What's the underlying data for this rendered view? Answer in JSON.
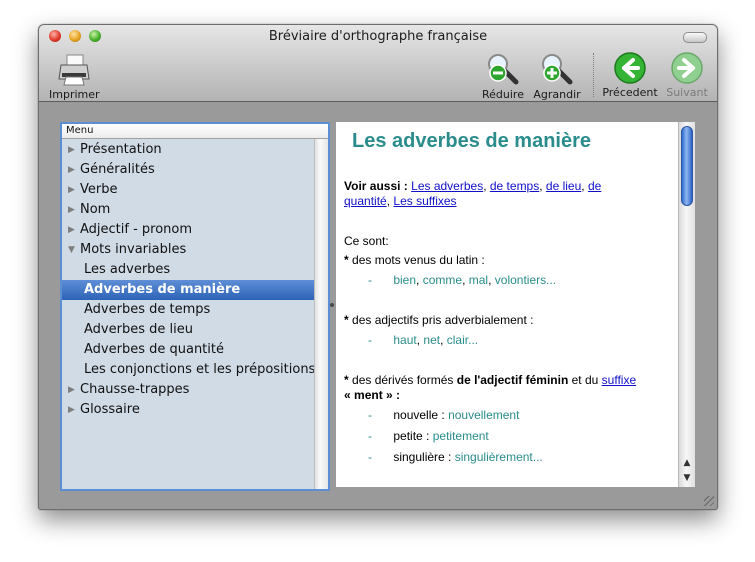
{
  "window": {
    "title": "Bréviaire d'orthographe française"
  },
  "toolbar": {
    "print_label": "Imprimer",
    "reduce_label": "Réduire",
    "enlarge_label": "Agrandir",
    "previous_label": "Précedent",
    "next_label": "Suivant"
  },
  "sidebar": {
    "header": "Menu",
    "items": [
      {
        "label": "Présentation",
        "arrow": "▶"
      },
      {
        "label": "Généralités",
        "arrow": "▶"
      },
      {
        "label": "Verbe",
        "arrow": "▶"
      },
      {
        "label": "Nom",
        "arrow": "▶"
      },
      {
        "label": "Adjectif - pronom",
        "arrow": "▶"
      },
      {
        "label": "Mots invariables",
        "arrow": "▼"
      },
      {
        "label": "Les adverbes"
      },
      {
        "label": "Adverbes de manière"
      },
      {
        "label": "Adverbes de temps"
      },
      {
        "label": "Adverbes de lieu"
      },
      {
        "label": "Adverbes de quantité"
      },
      {
        "label": "Les conjonctions et les prépositions"
      },
      {
        "label": "Chausse-trappes",
        "arrow": "▶"
      },
      {
        "label": "Glossaire",
        "arrow": "▶"
      }
    ]
  },
  "content": {
    "title": "Les adverbes de manière",
    "voir_aussi": {
      "label": "Voir aussi :",
      "link1": "Les adverbes",
      "sep": ",",
      "link2": "de temps",
      "link3": "de lieu",
      "link4a": "de",
      "link4b": "quantité",
      "link5": "Les suffixes"
    },
    "intro": "Ce sont:",
    "section1": {
      "bullet": "*",
      "text": "des mots venus du latin :",
      "dash": "-",
      "w1": "bien",
      "w2": "comme",
      "w3": "mal",
      "w4": "volontiers...",
      "comma": ","
    },
    "section2": {
      "bullet": "*",
      "text": "des adjectifs pris adverbialement :",
      "dash": "-",
      "w1": "haut",
      "w2": "net",
      "w3": "clair..."
    },
    "section3": {
      "bullet": "*",
      "text": "des dérivés formés",
      "bold1": "de l'adjectif féminin",
      "and": "et du",
      "link": "suffixe",
      "line2a": "«",
      "line2bold": "ment",
      "line2b": "» :",
      "rows": [
        {
          "dash": "-",
          "adj": "nouvelle :",
          "adv": "nouvellement"
        },
        {
          "dash": "-",
          "adj": "petite :",
          "adv": "petitement"
        },
        {
          "dash": "-",
          "adj": "singulière :",
          "adv": "singulièrement..."
        }
      ]
    }
  },
  "colors": {
    "accent_teal": "#2a8c8c",
    "link_blue": "#1010c8",
    "selection_blue": "#3a6fc4",
    "sidebar_bg": "#d1dbe6"
  }
}
